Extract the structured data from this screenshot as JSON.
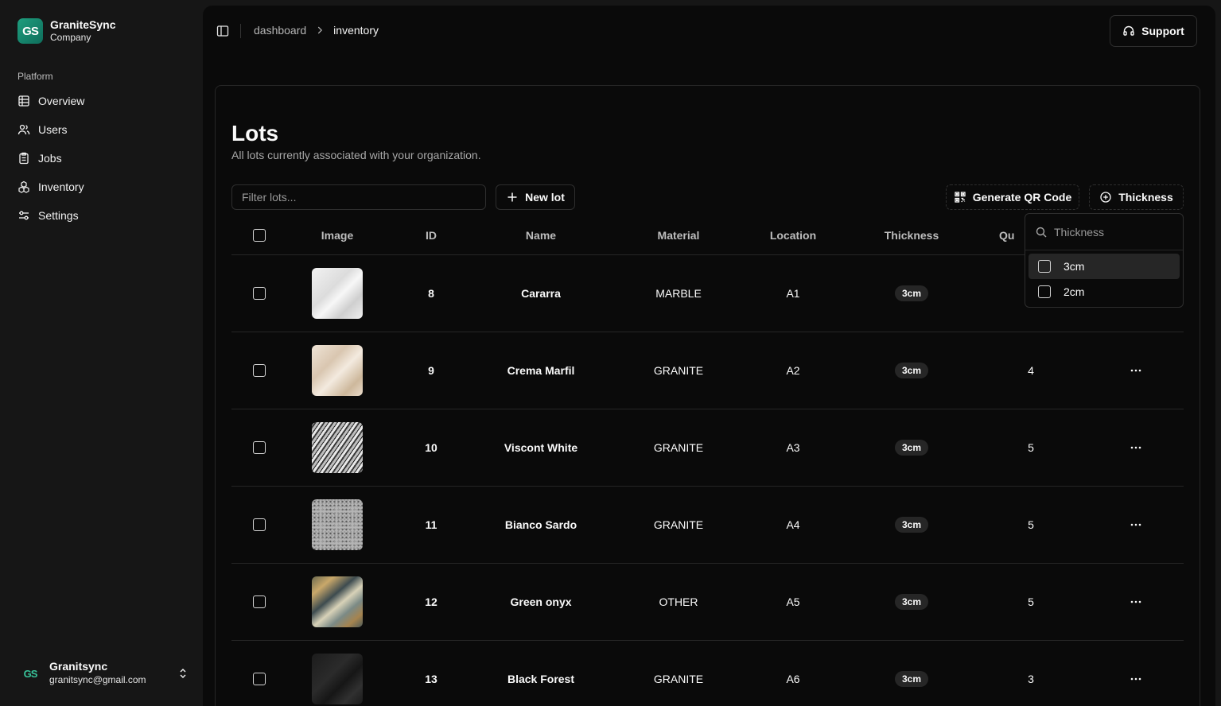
{
  "brand": {
    "logo": "GS",
    "name": "GraniteSync",
    "subtitle": "Company"
  },
  "sidebar": {
    "group_label": "Platform",
    "items": [
      {
        "label": "Overview",
        "icon": "table-icon"
      },
      {
        "label": "Users",
        "icon": "users-icon"
      },
      {
        "label": "Jobs",
        "icon": "clipboard-icon"
      },
      {
        "label": "Inventory",
        "icon": "cubes-icon"
      },
      {
        "label": "Settings",
        "icon": "sliders-icon"
      }
    ]
  },
  "user": {
    "avatar": "GS",
    "name": "Granitsync",
    "email": "granitsync@gmail.com"
  },
  "breadcrumb": {
    "parent": "dashboard",
    "current": "inventory"
  },
  "support_label": "Support",
  "page": {
    "title": "Lots",
    "subtitle": "All lots currently associated with your organization."
  },
  "toolbar": {
    "filter_placeholder": "Filter lots...",
    "new_lot_label": "New lot",
    "qr_label": "Generate QR Code",
    "thickness_label": "Thickness"
  },
  "table": {
    "headers": {
      "image": "Image",
      "id": "ID",
      "name": "Name",
      "material": "Material",
      "location": "Location",
      "thickness": "Thickness",
      "quantity": "Qu"
    },
    "rows": [
      {
        "id": "8",
        "name": "Cararra",
        "material": "MARBLE",
        "location": "A1",
        "thickness": "3cm",
        "quantity": "",
        "thumb": "marble-white"
      },
      {
        "id": "9",
        "name": "Crema Marfil",
        "material": "GRANITE",
        "location": "A2",
        "thickness": "3cm",
        "quantity": "4",
        "thumb": "crema"
      },
      {
        "id": "10",
        "name": "Viscont White",
        "material": "GRANITE",
        "location": "A3",
        "thickness": "3cm",
        "quantity": "5",
        "thumb": "viscont"
      },
      {
        "id": "11",
        "name": "Bianco Sardo",
        "material": "GRANITE",
        "location": "A4",
        "thickness": "3cm",
        "quantity": "5",
        "thumb": "speckled"
      },
      {
        "id": "12",
        "name": "Green onyx",
        "material": "OTHER",
        "location": "A5",
        "thickness": "3cm",
        "quantity": "5",
        "thumb": "onyx"
      },
      {
        "id": "13",
        "name": "Black Forest",
        "material": "GRANITE",
        "location": "A6",
        "thickness": "3cm",
        "quantity": "3",
        "thumb": "black"
      }
    ]
  },
  "thickness_dropdown": {
    "search_placeholder": "Thickness",
    "options": [
      {
        "label": "3cm",
        "checked": false
      },
      {
        "label": "2cm",
        "checked": false
      }
    ]
  },
  "colors": {
    "background": "#0a0a0a",
    "sidebar": "#161616",
    "border": "#262626",
    "brand": "#1e9e7e"
  }
}
